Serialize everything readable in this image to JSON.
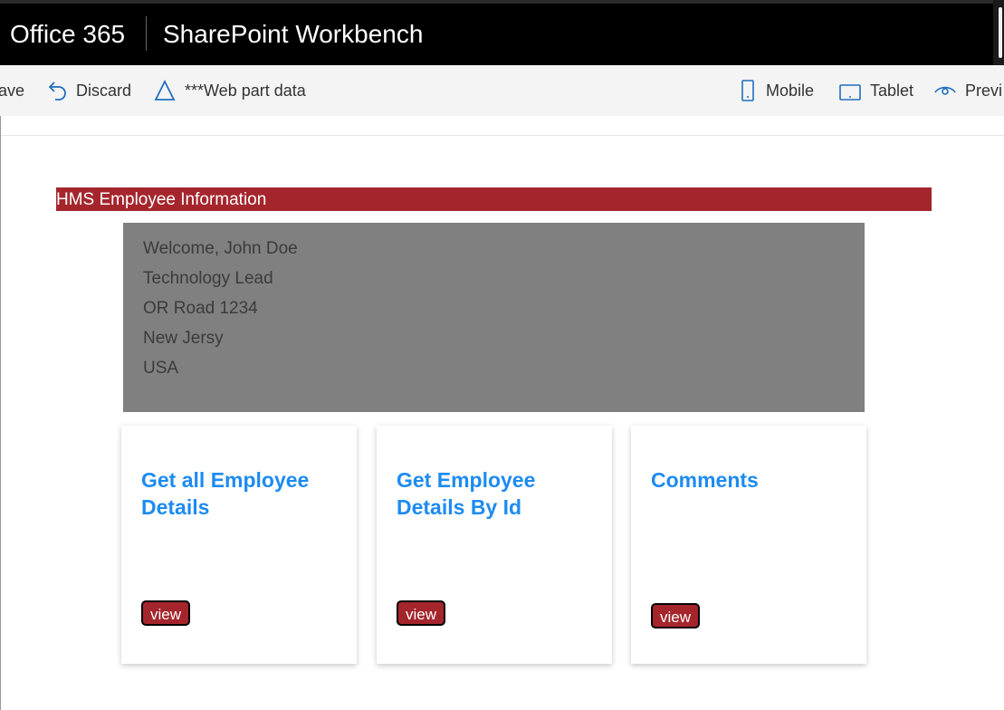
{
  "suitebar": {
    "brand": "Office 365",
    "app_title": "SharePoint Workbench"
  },
  "commands": {
    "save": "ave",
    "discard": "Discard",
    "webpart_data": "***Web part data",
    "mobile": "Mobile",
    "tablet": "Tablet",
    "preview": "Previ"
  },
  "icons": {
    "discard": "undo-icon",
    "webpart_data": "triangle-icon",
    "mobile": "phone-icon",
    "tablet": "tablet-icon",
    "preview": "eye-icon"
  },
  "colors": {
    "accent": "#1d8bf1",
    "header_bg": "#a4262c",
    "info_bg": "#808080",
    "suitebar_bg": "#000000"
  },
  "webpart": {
    "header": "HMS Employee Information",
    "info_lines": [
      "Welcome, John Doe",
      "Technology Lead",
      "OR Road 1234",
      "New Jersy",
      "USA"
    ]
  },
  "cards": [
    {
      "title": "Get all Employee Details",
      "button": "view"
    },
    {
      "title": "Get Employee Details By Id",
      "button": "view"
    },
    {
      "title": "Comments",
      "button": "view"
    }
  ]
}
